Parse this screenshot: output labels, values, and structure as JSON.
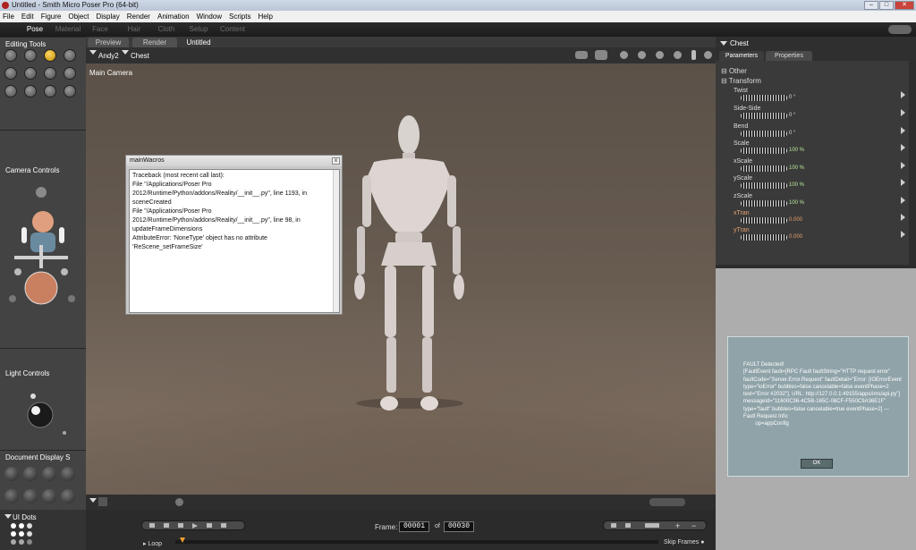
{
  "window": {
    "title": "Untitled - Smith Micro Poser Pro  (64-bit)",
    "controls": [
      "minimize",
      "maximize",
      "close"
    ]
  },
  "menubar": [
    "File",
    "Edit",
    "Figure",
    "Object",
    "Display",
    "Render",
    "Animation",
    "Window",
    "Scripts",
    "Help"
  ],
  "rooms": [
    "Pose",
    "Material",
    "Face",
    "Hair",
    "Cloth",
    "Setup",
    "Content"
  ],
  "active_room": "Pose",
  "left_panel": {
    "editing_tools_title": "Editing Tools",
    "camera_controls_title": "Camera Controls",
    "light_controls_title": "Light Controls",
    "document_display_title": "Document Display S"
  },
  "viewport": {
    "tabs": [
      "Preview",
      "Render"
    ],
    "document_title": "Untitled",
    "figure_select": "Andy2",
    "actor_select": "Chest",
    "camera_label": "Main Camera"
  },
  "script_window": {
    "title": "mainWacros",
    "lines": [
      "Traceback (most recent call last):",
      "  File \"/Applications/Poser Pro",
      "2012/Runtime/Python/addons/Reality/__init__.py\", line 1193, in",
      "sceneCreated",
      "  File \"/Applications/Poser Pro",
      "2012/Runtime/Python/addons/Reality/__init__.py\", line 98, in",
      "updateFrameDimensions",
      "AttributeError: 'NoneType' object has no attribute",
      "'ReScene_setFrameSize'"
    ]
  },
  "right_panel": {
    "actor_title": "Chest",
    "tabs": [
      "Parameters",
      "Properties"
    ],
    "active_tab": "Parameters",
    "groups": [
      "Other",
      "Transform"
    ],
    "parameters": [
      {
        "name": "Twist",
        "value": "0 °",
        "color": "white"
      },
      {
        "name": "Side-Side",
        "value": "0 °",
        "color": "white"
      },
      {
        "name": "Bend",
        "value": "0 °",
        "color": "white"
      },
      {
        "name": "Scale",
        "value": "100 %",
        "color": "green"
      },
      {
        "name": "xScale",
        "value": "100 %",
        "color": "green"
      },
      {
        "name": "yScale",
        "value": "100 %",
        "color": "green"
      },
      {
        "name": "zScale",
        "value": "100 %",
        "color": "green"
      },
      {
        "name": "xTran",
        "value": "0.000",
        "color": "orange"
      },
      {
        "name": "yTran",
        "value": "0.000",
        "color": "orange"
      }
    ]
  },
  "fault_dialog": {
    "text": "FAULT Detected!\n[FaultEvent fault=[RPC Fault faultString=\"HTTP request error\" faultCode=\"Server.Error.Request\" faultDetail=\"Error: [IOErrorEvent type=\"ioError\" bubbles=false cancelable=false eventPhase=2 text=\"Error #2032\"]. URL: http://127.0.0.1:49155/apps/ims/api.py\"] messageId=\"11600C36-4C5B-165C-08CF-F550C9A36E1F\" type=\"fault\" bubbles=false cancelable=true eventPhase=2] --- Fault Request Info:\n        op=appConfig",
    "ok_label": "OK"
  },
  "animation": {
    "ui_dots_label": "UI Dots",
    "frame_label": "Frame:",
    "current_frame": "00001",
    "of_label": "of",
    "total_frames": "00030",
    "loop_label": "Loop",
    "skip_frames_label": "Skip Frames"
  }
}
